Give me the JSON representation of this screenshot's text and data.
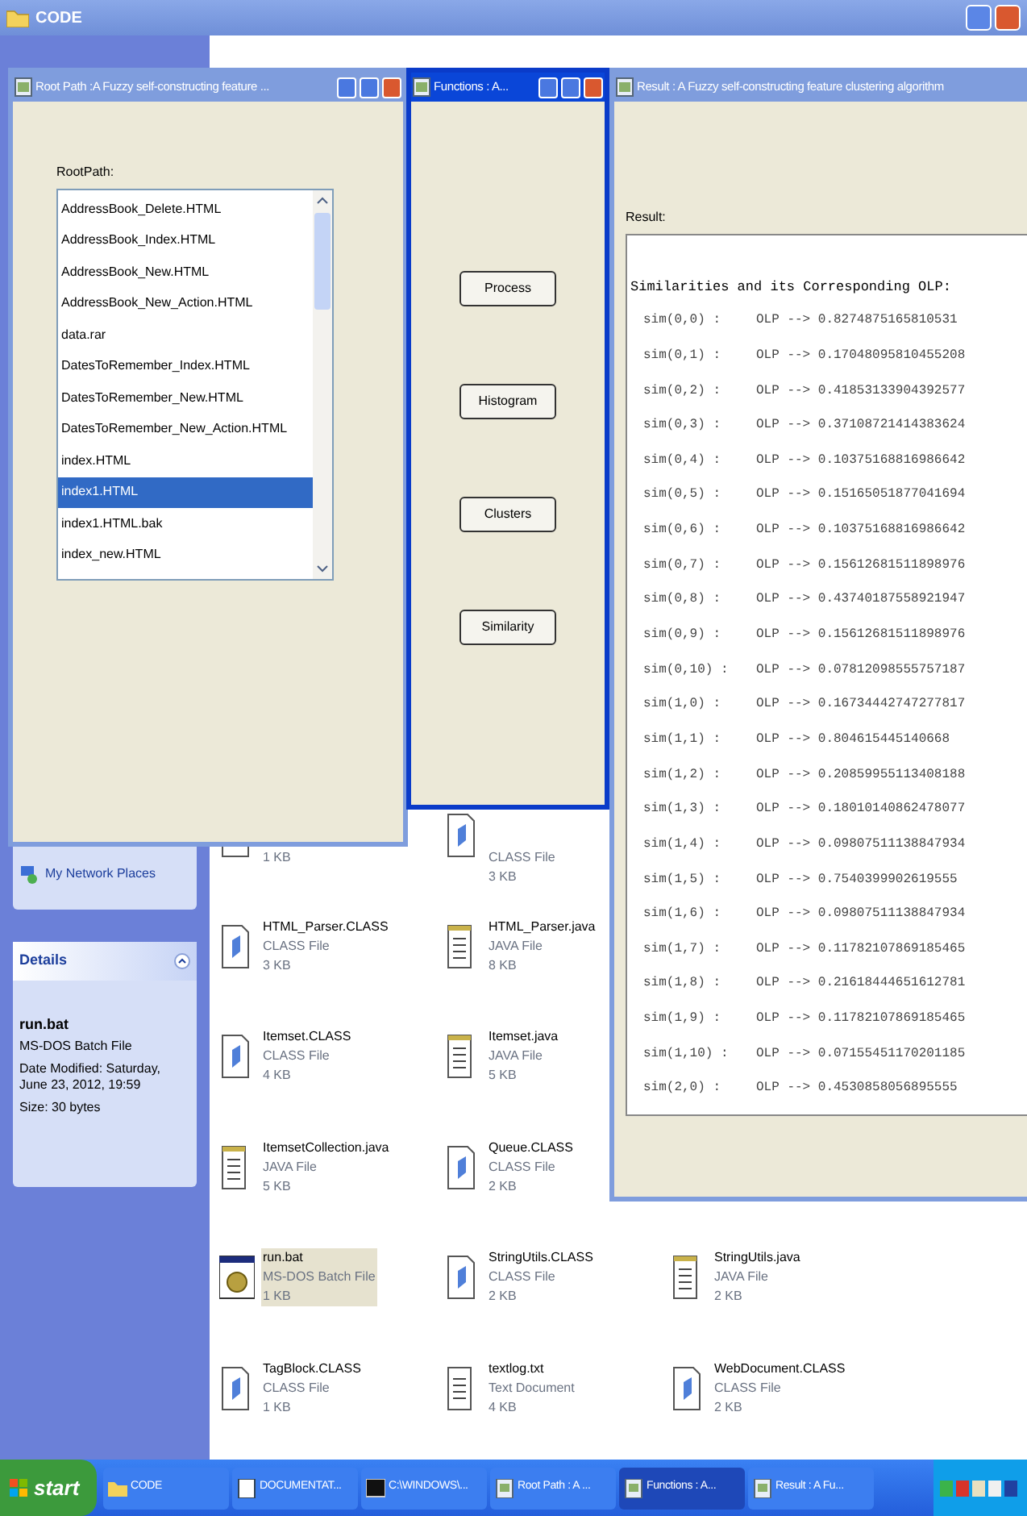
{
  "explorer": {
    "title": "CODE",
    "network_link": "My Network Places",
    "details": {
      "heading": "Details",
      "name": "run.bat",
      "type": "MS-DOS Batch File",
      "modified": "Date Modified: Saturday, June 23, 2012, 19:59",
      "size": "Size: 30 bytes"
    },
    "file_rows": [
      {
        "cells": [
          {
            "kind": "class",
            "size": "1 KB"
          },
          {
            "kind": "class",
            "type": "CLASS File",
            "size": "3 KB"
          }
        ]
      },
      {
        "cells": [
          {
            "kind": "class",
            "name": "HTML_Parser.CLASS",
            "type": "CLASS File",
            "size": "3 KB"
          },
          {
            "kind": "java",
            "name": "HTML_Parser.java",
            "type": "JAVA File",
            "size": "8 KB"
          }
        ]
      },
      {
        "cells": [
          {
            "kind": "class",
            "name": "Itemset.CLASS",
            "type": "CLASS File",
            "size": "4 KB"
          },
          {
            "kind": "java",
            "name": "Itemset.java",
            "type": "JAVA File",
            "size": "5 KB"
          }
        ]
      },
      {
        "cells": [
          {
            "kind": "java",
            "name": "ItemsetCollection.java",
            "type": "JAVA File",
            "size": "5 KB"
          },
          {
            "kind": "class",
            "name": "Queue.CLASS",
            "type": "CLASS File",
            "size": "2 KB"
          }
        ]
      },
      {
        "cells": [
          {
            "kind": "bat",
            "name": "run.bat",
            "type": "MS-DOS Batch File",
            "size": "1 KB",
            "selected": true
          },
          {
            "kind": "class",
            "name": "StringUtils.CLASS",
            "type": "CLASS File",
            "size": "2 KB",
            "selected": false
          },
          {
            "kind": "java",
            "name": "StringUtils.java",
            "type": "JAVA File",
            "size": "2 KB",
            "selected": false
          }
        ]
      },
      {
        "cells": [
          {
            "kind": "class",
            "name": "TagBlock.CLASS",
            "type": "CLASS File",
            "size": "1 KB"
          },
          {
            "kind": "txt",
            "name": "textlog.txt",
            "type": "Text Document",
            "size": "4 KB"
          },
          {
            "kind": "class",
            "name": "WebDocument.CLASS",
            "type": "CLASS File",
            "size": "2 KB"
          }
        ]
      }
    ]
  },
  "root_path_window": {
    "title": "Root Path :A Fuzzy self-constructing feature ...",
    "active": false,
    "label": "RootPath:",
    "items": [
      {
        "label": "AddressBook_Delete.HTML",
        "selected": false
      },
      {
        "label": "AddressBook_Index.HTML",
        "selected": false
      },
      {
        "label": "AddressBook_New.HTML",
        "selected": false
      },
      {
        "label": "AddressBook_New_Action.HTML",
        "selected": false
      },
      {
        "label": "data.rar",
        "selected": false
      },
      {
        "label": "DatesToRemember_Index.HTML",
        "selected": false
      },
      {
        "label": "DatesToRemember_New.HTML",
        "selected": false
      },
      {
        "label": "DatesToRemember_New_Action.HTML",
        "selected": false
      },
      {
        "label": "index.HTML",
        "selected": false
      },
      {
        "label": "index1.HTML",
        "selected": true
      },
      {
        "label": "index1.HTML.bak",
        "selected": false
      },
      {
        "label": "index_new.HTML",
        "selected": false
      }
    ]
  },
  "functions_window": {
    "title": "Functions : A...",
    "active": true,
    "buttons": [
      "Process",
      "Histogram",
      "Clusters",
      "Similarity"
    ]
  },
  "result_window": {
    "title": "Result : A Fuzzy self-constructing feature clustering algorithm",
    "active": false,
    "label": "Result:",
    "heading": "Similarities and its Corresponding OLP:",
    "rows": [
      {
        "pair": "sim(0,0) :",
        "olp": "OLP --> 0.8274875165810531"
      },
      {
        "pair": "sim(0,1) :",
        "olp": "OLP --> 0.17048095810455208"
      },
      {
        "pair": "sim(0,2) :",
        "olp": "OLP --> 0.41853133904392577"
      },
      {
        "pair": "sim(0,3) :",
        "olp": "OLP --> 0.37108721414383624"
      },
      {
        "pair": "sim(0,4) :",
        "olp": "OLP --> 0.10375168816986642"
      },
      {
        "pair": "sim(0,5) :",
        "olp": "OLP --> 0.15165051877041694"
      },
      {
        "pair": "sim(0,6) :",
        "olp": "OLP --> 0.10375168816986642"
      },
      {
        "pair": "sim(0,7) :",
        "olp": "OLP --> 0.15612681511898976"
      },
      {
        "pair": "sim(0,8) :",
        "olp": "OLP --> 0.43740187558921947"
      },
      {
        "pair": "sim(0,9) :",
        "olp": "OLP --> 0.15612681511898976"
      },
      {
        "pair": "sim(0,10) :",
        "olp": "OLP --> 0.07812098555757187"
      },
      {
        "pair": "sim(1,0) :",
        "olp": "OLP --> 0.16734442747277817"
      },
      {
        "pair": "sim(1,1) :",
        "olp": "OLP --> 0.804615445140668"
      },
      {
        "pair": "sim(1,2) :",
        "olp": "OLP --> 0.20859955113408188"
      },
      {
        "pair": "sim(1,3) :",
        "olp": "OLP --> 0.18010140862478077"
      },
      {
        "pair": "sim(1,4) :",
        "olp": "OLP --> 0.09807511138847934"
      },
      {
        "pair": "sim(1,5) :",
        "olp": "OLP --> 0.7540399902619555"
      },
      {
        "pair": "sim(1,6) :",
        "olp": "OLP --> 0.09807511138847934"
      },
      {
        "pair": "sim(1,7) :",
        "olp": "OLP --> 0.11782107869185465"
      },
      {
        "pair": "sim(1,8) :",
        "olp": "OLP --> 0.21618444651612781"
      },
      {
        "pair": "sim(1,9) :",
        "olp": "OLP --> 0.11782107869185465"
      },
      {
        "pair": "sim(1,10) :",
        "olp": "OLP --> 0.07155451170201185"
      },
      {
        "pair": "sim(2,0) :",
        "olp": "OLP --> 0.4530858056895555"
      }
    ]
  },
  "taskbar": {
    "start": "start",
    "tasks": [
      {
        "label": "CODE",
        "kind": "folder",
        "selected": false
      },
      {
        "label": "DOCUMENTAT...",
        "kind": "doc",
        "selected": false
      },
      {
        "label": "C:\\WINDOWS\\...",
        "kind": "console",
        "selected": false
      },
      {
        "label": "Root Path : A ...",
        "kind": "app",
        "selected": false
      },
      {
        "label": "Functions : A...",
        "kind": "app",
        "selected": true
      },
      {
        "label": "Result : A Fu...",
        "kind": "app",
        "selected": false
      }
    ]
  }
}
